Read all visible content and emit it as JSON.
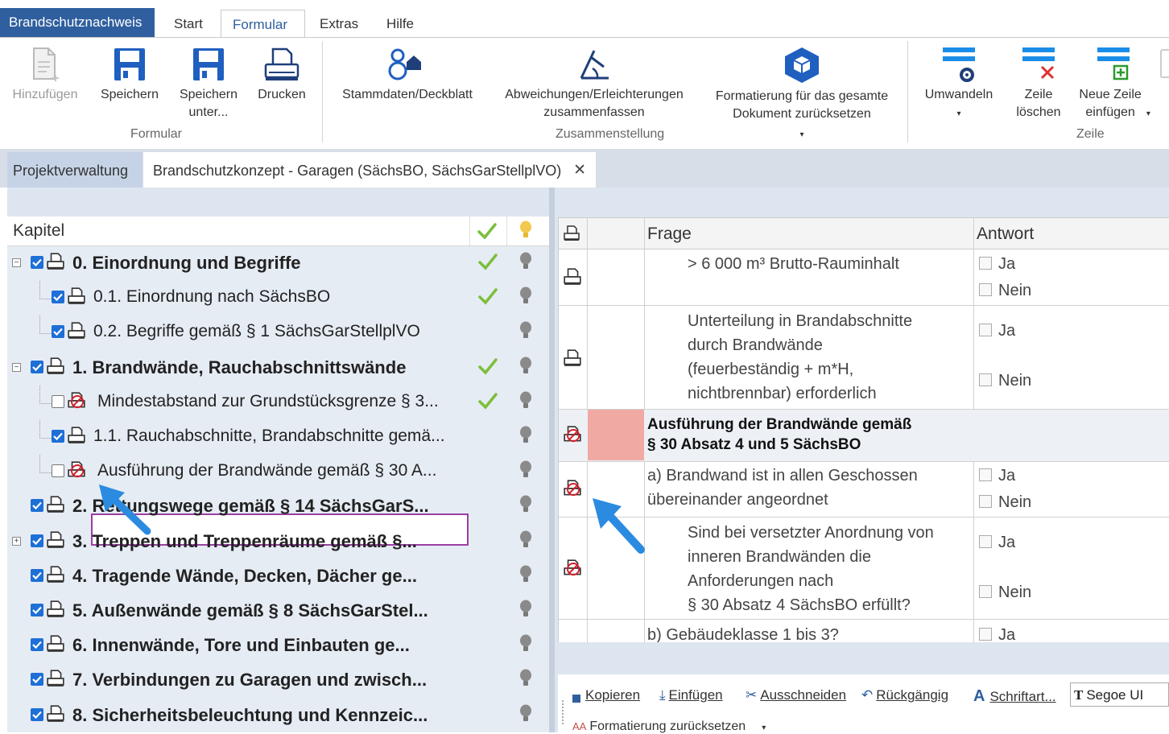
{
  "ribbon": {
    "app_tab": "Brandschutznachweis",
    "tabs": [
      "Start",
      "Formular",
      "Extras",
      "Hilfe"
    ],
    "active_tab": "Formular",
    "buttons": {
      "add": "Hinzufügen",
      "save": "Speichern",
      "save_as": "Speichern unter...",
      "print": "Drucken",
      "master": "Stammdaten/Deckblatt",
      "deviations": "Abweichungen/Erleichterungen zusammenfassen",
      "reset_format": "Formatierung für das gesamte Dokument zurücksetzen",
      "convert": "Umwandeln",
      "delete_row": "Zeile löschen",
      "new_row": "Neue Zeile einfügen"
    },
    "groups": {
      "form": "Formular",
      "compile": "Zusammenstellung",
      "row": "Zeile"
    }
  },
  "doc_tabs": {
    "project": "Projektverwaltung",
    "document": "Brandschutzkonzept - Garagen (SächsBO, SächsGarStellplVO)",
    "close": "✕"
  },
  "tree": {
    "header": "Kapitel",
    "items": [
      {
        "label": "0. Einordnung und Begriffe",
        "bold": true,
        "checked": true,
        "done": true
      },
      {
        "label": "0.1. Einordnung nach SächsBO",
        "bold": false,
        "checked": true,
        "done": true
      },
      {
        "label": "0.2. Begriffe gemäß § 1 SächsGarStellplVO",
        "bold": false,
        "checked": true,
        "done": false
      },
      {
        "label": "1. Brandwände, Rauchabschnittswände",
        "bold": true,
        "checked": true,
        "done": true
      },
      {
        "label": "Mindestabstand zur Grundstücksgrenze § 3...",
        "bold": false,
        "checked": false,
        "done": true
      },
      {
        "label": "1.1. Rauchabschnitte, Brandabschnitte gemä...",
        "bold": false,
        "checked": true,
        "done": false
      },
      {
        "label": "Ausführung der Brandwände gemäß § 30 A...",
        "bold": false,
        "checked": false,
        "done": false
      },
      {
        "label": "2. Rettungswege gemäß § 14 SächsGarS...",
        "bold": true,
        "checked": true,
        "done": false
      },
      {
        "label": "3. Treppen und Treppenräume gemäß §...",
        "bold": true,
        "checked": true,
        "done": false
      },
      {
        "label": "4. Tragende Wände, Decken, Dächer ge...",
        "bold": true,
        "checked": true,
        "done": false
      },
      {
        "label": "5. Außenwände gemäß § 8 SächsGarStel...",
        "bold": true,
        "checked": true,
        "done": false
      },
      {
        "label": "6. Innenwände, Tore und Einbauten ge...",
        "bold": true,
        "checked": true,
        "done": false
      },
      {
        "label": "7. Verbindungen zu Garagen und zwisch...",
        "bold": true,
        "checked": true,
        "done": false
      },
      {
        "label": "8. Sicherheitsbeleuchtung und Kennzeic...",
        "bold": true,
        "checked": true,
        "done": false
      }
    ]
  },
  "grid": {
    "col_question": "Frage",
    "col_answer": "Antwort",
    "yes": "Ja",
    "no": "Nein",
    "rows": {
      "r1": "> 6 000 m³ Brutto-Rauminhalt",
      "r2_l1": "Unterteilung in Brandabschnitte",
      "r2_l2": "durch Brandwände",
      "r2_l3": "(feuerbeständig + m*H,",
      "r2_l4": "nichtbrennbar) erforderlich",
      "r3_l1": "Ausführung der Brandwände gemäß",
      "r3_l2": "§ 30 Absatz 4 und 5 SächsBO",
      "r4_l1": "a) Brandwand ist in allen Geschossen",
      "r4_l2": "übereinander angeordnet",
      "r5_l1": "Sind bei versetzter Anordnung von",
      "r5_l2": "inneren Brandwänden die",
      "r5_l3": "Anforderungen nach",
      "r5_l4": "§ 30 Absatz 4 SächsBO erfüllt?",
      "r6": "b) Gebäudeklasse 1 bis 3?"
    }
  },
  "toolbar": {
    "copy": "Kopieren",
    "paste": "Einfügen",
    "cut": "Ausschneiden",
    "undo": "Rückgängig",
    "font_label": "Schriftart...",
    "font_value": "Segoe UI",
    "reset_format": "Formatierung zurücksetzen"
  },
  "colors": {
    "app_blue": "#2f5f9e",
    "check_blue": "#1e6fd6",
    "done_green": "#7bbf3a",
    "pink": "#f1a9a3",
    "selection_purple": "#9b3fa3",
    "arrow_blue": "#2a8be0"
  }
}
